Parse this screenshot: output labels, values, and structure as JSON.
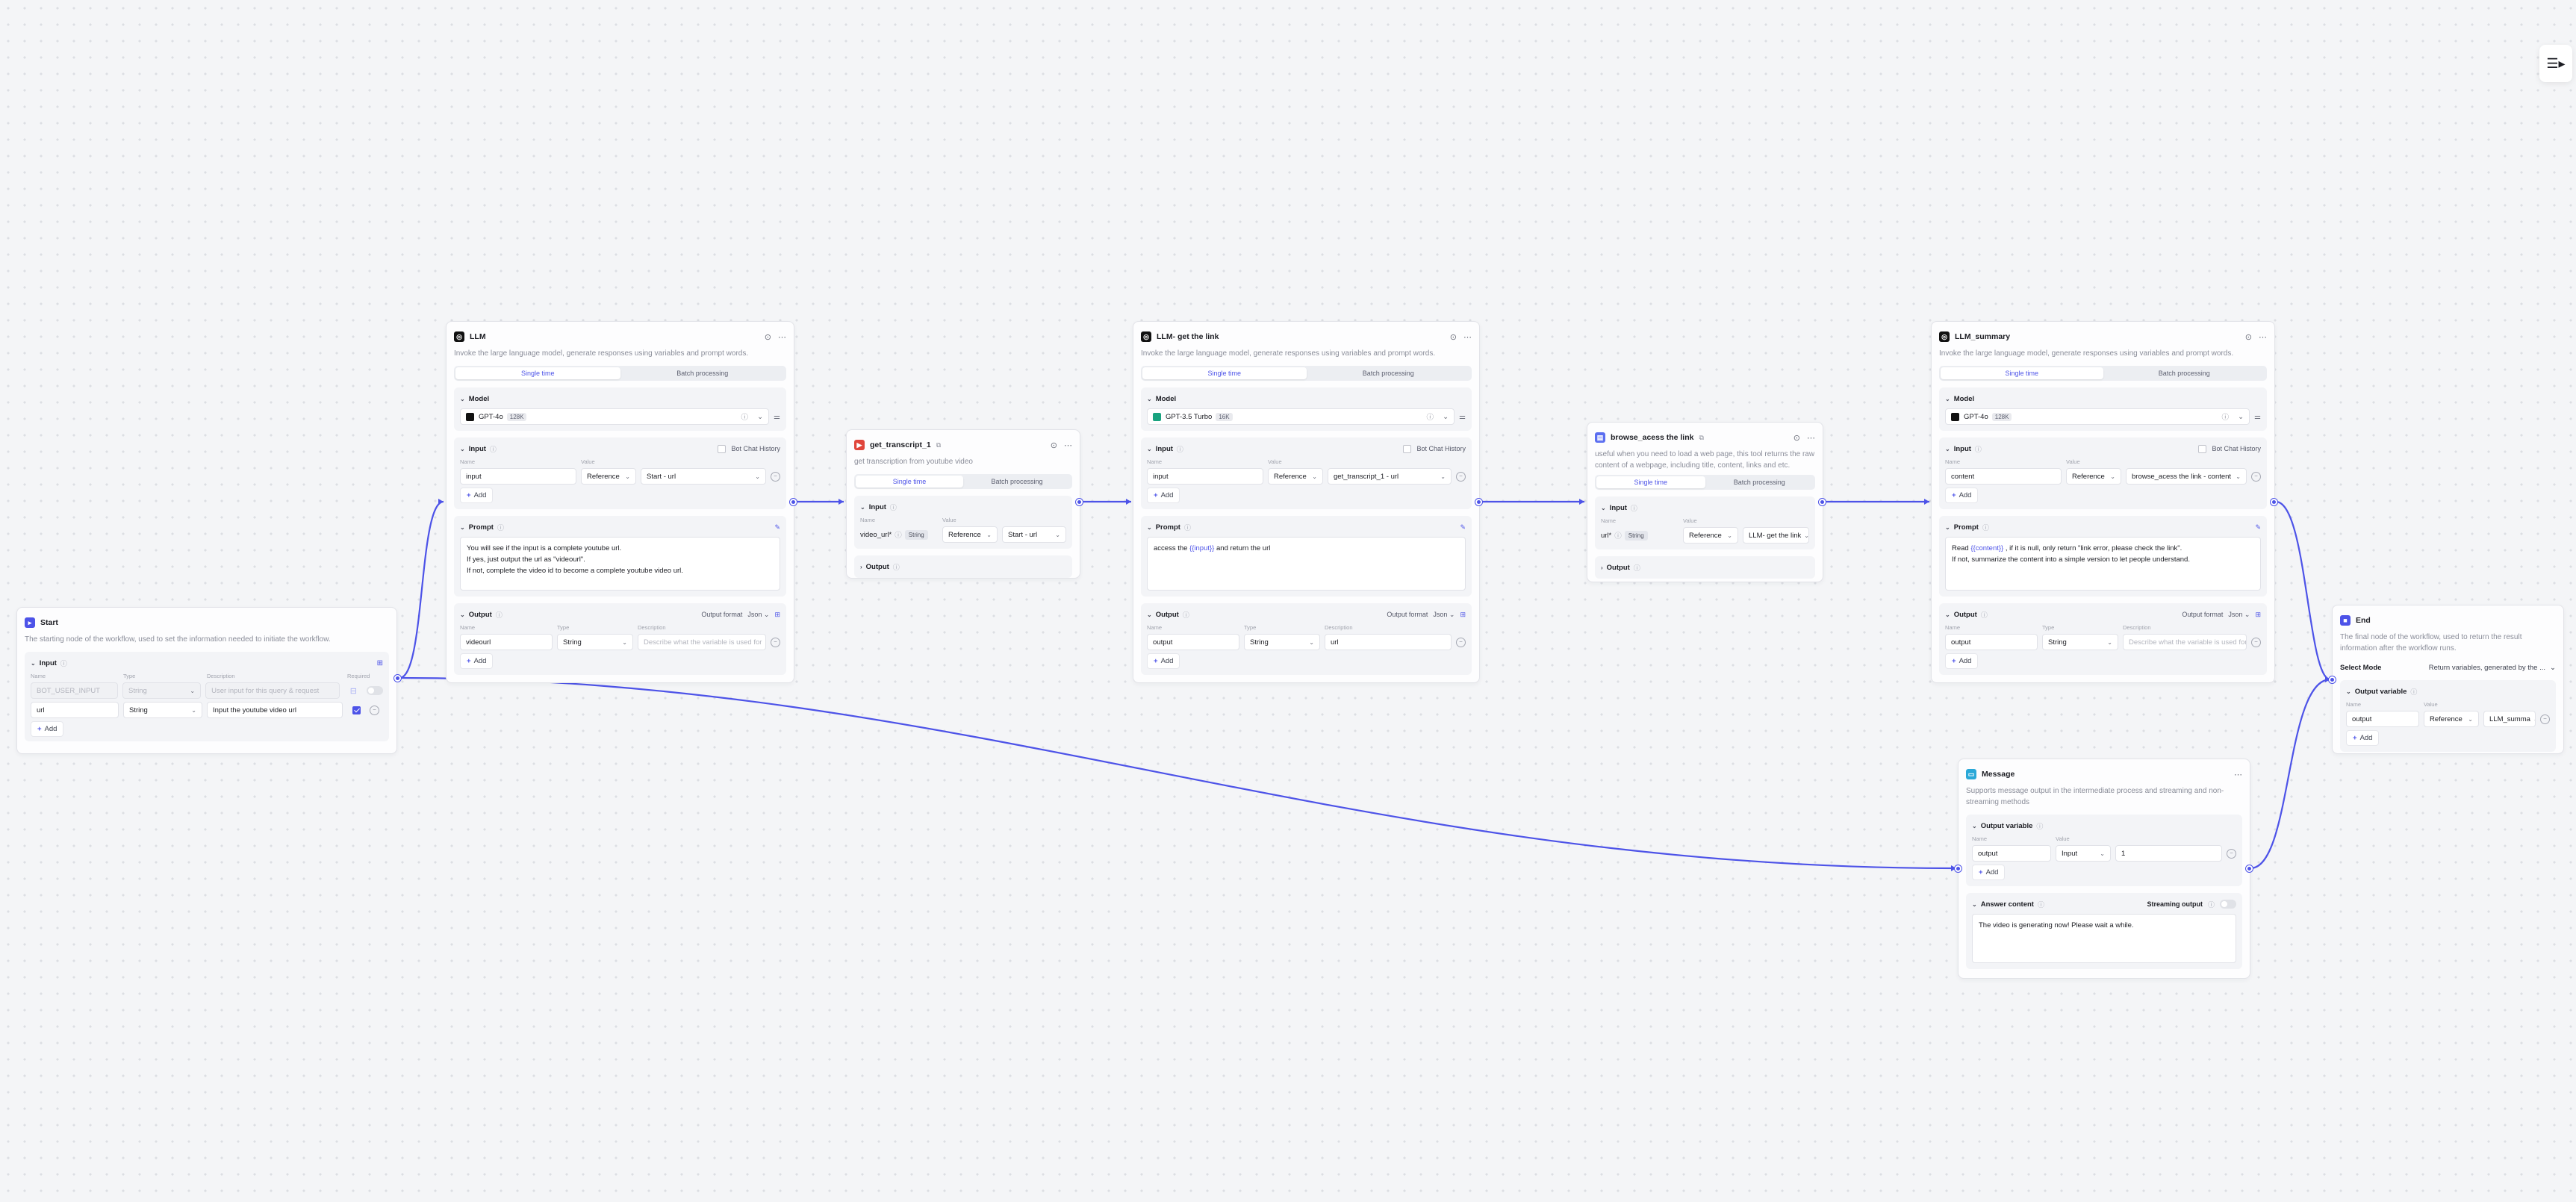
{
  "common": {
    "single_time": "Single time",
    "batch_processing": "Batch processing",
    "add": "Add",
    "col_name": "Name",
    "col_type": "Type",
    "col_value": "Value",
    "col_description": "Description",
    "col_required": "Required",
    "reference": "Reference",
    "input_mode": "Input",
    "string": "String",
    "json": "Json",
    "output_format": "Output format",
    "bot_chat_history": "Bot Chat History",
    "describe_placeholder": "Describe what the variable is used for"
  },
  "start": {
    "title": "Start",
    "desc": "The starting node of the workflow, used to set the information needed to initiate the workflow.",
    "input_label": "Input",
    "rows": [
      {
        "name": "BOT_USER_INPUT",
        "type": "String",
        "desc": "User input for this query & request",
        "required": false,
        "disabled": true
      },
      {
        "name": "url",
        "type": "String",
        "desc": "Input the youtube video url",
        "required": true,
        "disabled": false
      }
    ]
  },
  "llm1": {
    "title": "LLM",
    "desc": "Invoke the large language model, generate responses using variables and prompt words.",
    "model_label": "Model",
    "model": "GPT-4o",
    "model_ctx": "128K",
    "input_label": "Input",
    "input_name": "input",
    "input_value": "Start - url",
    "prompt_label": "Prompt",
    "prompt_lines": [
      "You will see if the input is a complete youtube url.",
      "If yes, just output the url as \"videourl\".",
      "If not, complete the video id to become a complete youtube video url."
    ],
    "output_label": "Output",
    "output_name": "videourl"
  },
  "transcript": {
    "title": "get_transcript_1",
    "desc": "get transcription from youtube video",
    "input_label": "Input",
    "input_name": "video_url*",
    "input_value": "Start - url",
    "output_label": "Output"
  },
  "llm2": {
    "title": "LLM- get the link",
    "desc": "Invoke the large language model, generate responses using variables and prompt words.",
    "model_label": "Model",
    "model": "GPT-3.5 Turbo",
    "model_ctx": "16K",
    "input_label": "Input",
    "input_name": "input",
    "input_value": "get_transcript_1 - url",
    "prompt_label": "Prompt",
    "prompt_pre": "access the ",
    "prompt_var": "{{input}}",
    "prompt_post": " and return the url",
    "output_label": "Output",
    "output_name": "output",
    "output_desc": "url"
  },
  "browse": {
    "title": "browse_acess the link",
    "desc": "useful when you need to load a web page, this tool returns the raw content of a webpage, including title, content, links and etc.",
    "input_label": "Input",
    "input_name": "url*",
    "input_value": "LLM- get the link",
    "output_label": "Output"
  },
  "llm3": {
    "title": "LLM_summary",
    "desc": "Invoke the large language model, generate responses using variables and prompt words.",
    "model_label": "Model",
    "model": "GPT-4o",
    "model_ctx": "128K",
    "input_label": "Input",
    "input_name": "content",
    "input_value": "browse_acess the link - content",
    "prompt_label": "Prompt",
    "prompt_pre": "Read ",
    "prompt_var": "{{content}}",
    "prompt_post": " , if it is null, only return \"link error, please check the link\".",
    "prompt_line2": "If not, summarize the content into a simple version to let people understand.",
    "output_label": "Output",
    "output_name": "output"
  },
  "message": {
    "title": "Message",
    "desc": "Supports message output in the intermediate process and streaming and non-streaming methods",
    "output_var_label": "Output variable",
    "out_name": "output",
    "out_value": "1",
    "answer_label": "Answer content",
    "streaming_label": "Streaming output",
    "answer_text": "The video is generating now! Please wait a while."
  },
  "end": {
    "title": "End",
    "desc": "The final node of the workflow, used to return the result information after the workflow runs.",
    "select_mode_label": "Select Mode",
    "select_mode_value": "Return variables, generated by the ...",
    "output_var_label": "Output variable",
    "out_name": "output",
    "out_value": "LLM_summa"
  },
  "colors": {
    "accent": "#4d53e8",
    "edge": "#4d53e8",
    "canvas": "#f4f5f7",
    "node_border": "#e2e3e8"
  }
}
